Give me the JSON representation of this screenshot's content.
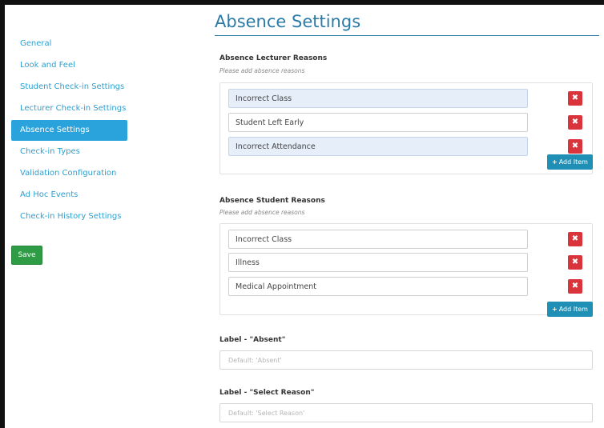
{
  "page": {
    "title": "Absence Settings"
  },
  "sidebar": {
    "items": [
      {
        "label": "General"
      },
      {
        "label": "Look and Feel"
      },
      {
        "label": "Student Check-in Settings"
      },
      {
        "label": "Lecturer Check-in Settings"
      },
      {
        "label": "Absence Settings",
        "active": true
      },
      {
        "label": "Check-in Types"
      },
      {
        "label": "Validation Configuration"
      },
      {
        "label": "Ad Hoc Events"
      },
      {
        "label": "Check-in History Settings"
      }
    ],
    "save_label": "Save"
  },
  "lecturer_reasons": {
    "heading": "Absence Lecturer Reasons",
    "hint": "Please add absence reasons",
    "items": [
      "Incorrect Class",
      "Student Left Early",
      "Incorrect Attendance"
    ],
    "delete_label": "✖",
    "add_label": "Add Item"
  },
  "student_reasons": {
    "heading": "Absence Student Reasons",
    "hint": "Please add absence reasons",
    "items": [
      "Incorrect Class",
      "Illness",
      "Medical Appointment"
    ],
    "delete_label": "✖",
    "add_label": "Add Item"
  },
  "label_absent": {
    "heading": "Label - \"Absent\"",
    "placeholder": "Default: 'Absent'"
  },
  "label_select_reason": {
    "heading": "Label - \"Select Reason\"",
    "placeholder": "Default: 'Select Reason'"
  },
  "colors": {
    "accent": "#2aa3dc",
    "title": "#2b7ba8",
    "save": "#2e9b45",
    "delete": "#d9343b",
    "add": "#1f8fb5"
  }
}
